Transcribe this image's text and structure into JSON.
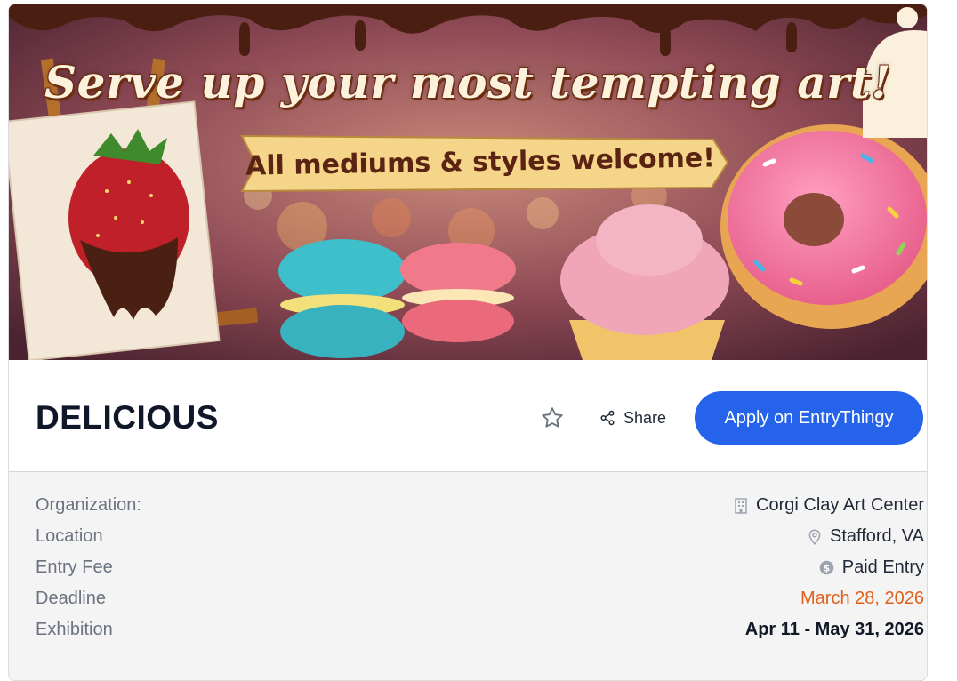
{
  "banner": {
    "headline": "Serve up your most tempting art!",
    "ribbon": "All mediums & styles welcome!"
  },
  "listing": {
    "title": "DELICIOUS",
    "share_label": "Share",
    "apply_label": "Apply on EntryThingy"
  },
  "details": {
    "organization": {
      "label": "Organization:",
      "value": "Corgi Clay Art Center",
      "icon": "building-icon"
    },
    "location": {
      "label": "Location",
      "value": "Stafford, VA",
      "icon": "map-pin-icon"
    },
    "entry_fee": {
      "label": "Entry Fee",
      "value": "Paid Entry",
      "icon": "dollar-coin-icon"
    },
    "deadline": {
      "label": "Deadline",
      "value": "March 28, 2026"
    },
    "exhibition": {
      "label": "Exhibition",
      "value": "Apr 11 - May 31, 2026"
    }
  },
  "colors": {
    "accent": "#2563eb",
    "deadline": "#e0611a",
    "title": "#0f1729",
    "panel_bg": "#f4f4f4"
  }
}
